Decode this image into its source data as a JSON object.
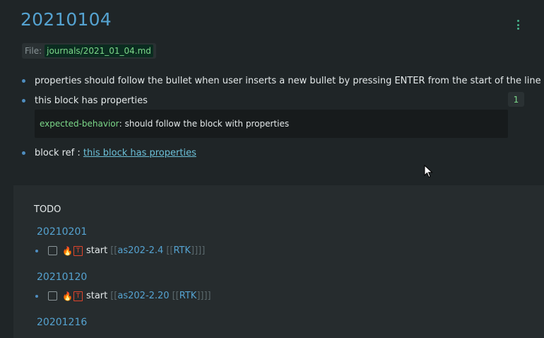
{
  "page": {
    "title": "20210104"
  },
  "file": {
    "label": "File:",
    "path": "journals/2021_01_04.md"
  },
  "blocks": [
    {
      "text": "properties should follow the bullet when user inserts a new bullet by pressing ENTER from the start of the line"
    },
    {
      "text": "this block has properties",
      "ref_count": "1",
      "property": {
        "key": "expected-behavior",
        "separator": ":",
        "value": "should follow the block with properties"
      }
    },
    {
      "prefix": "block ref : ",
      "link": "this block has properties"
    }
  ],
  "todo": {
    "title": "TODO",
    "groups": [
      {
        "date": "20210201",
        "task": {
          "marker_icon": "fire-icon",
          "badge": "T",
          "word": "start",
          "open": "[[",
          "page": "as202-2.4",
          "inner_open": "[[",
          "inner_page": "RTK",
          "close": "]]]]"
        }
      },
      {
        "date": "20210120",
        "task": {
          "marker_icon": "fire-icon",
          "badge": "T",
          "word": "start",
          "open": "[[",
          "page": "as202-2.20",
          "inner_open": "[[",
          "inner_page": "RTK",
          "close": "]]]]"
        }
      },
      {
        "date": "20201216"
      }
    ]
  },
  "colors": {
    "accent": "#55a3d1",
    "property_key": "#7cd889",
    "background": "#1f2527"
  }
}
